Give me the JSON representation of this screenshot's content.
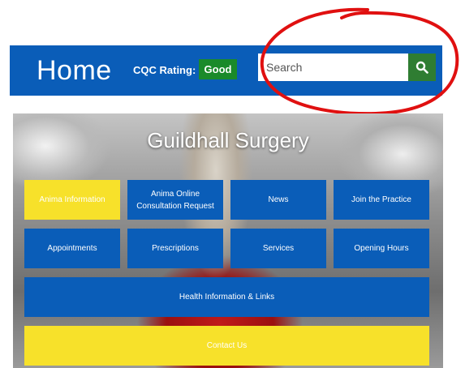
{
  "header": {
    "title": "Home",
    "cqc_label": "CQC Rating:",
    "cqc_value": "Good",
    "search_placeholder": "Search"
  },
  "hero": {
    "title": "Guildhall Surgery"
  },
  "tiles": [
    {
      "label": "Anima Information",
      "color": "yellow"
    },
    {
      "label": "Anima Online Consultation Request",
      "color": "blue"
    },
    {
      "label": "News",
      "color": "blue"
    },
    {
      "label": "Join the Practice",
      "color": "blue"
    },
    {
      "label": "Appointments",
      "color": "blue"
    },
    {
      "label": "Prescriptions",
      "color": "blue"
    },
    {
      "label": "Services",
      "color": "blue"
    },
    {
      "label": "Opening Hours",
      "color": "blue"
    },
    {
      "label": "Health Information & Links",
      "color": "blue"
    },
    {
      "label": "Contact Us",
      "color": "yellow"
    }
  ],
  "colors": {
    "brand_blue": "#0a5db8",
    "yellow": "#f7e12a",
    "badge_green": "#1a8a2a",
    "search_button_green": "#2f7d32",
    "annotation_red": "#e01010"
  },
  "icons": {
    "search_button": "search-icon"
  }
}
